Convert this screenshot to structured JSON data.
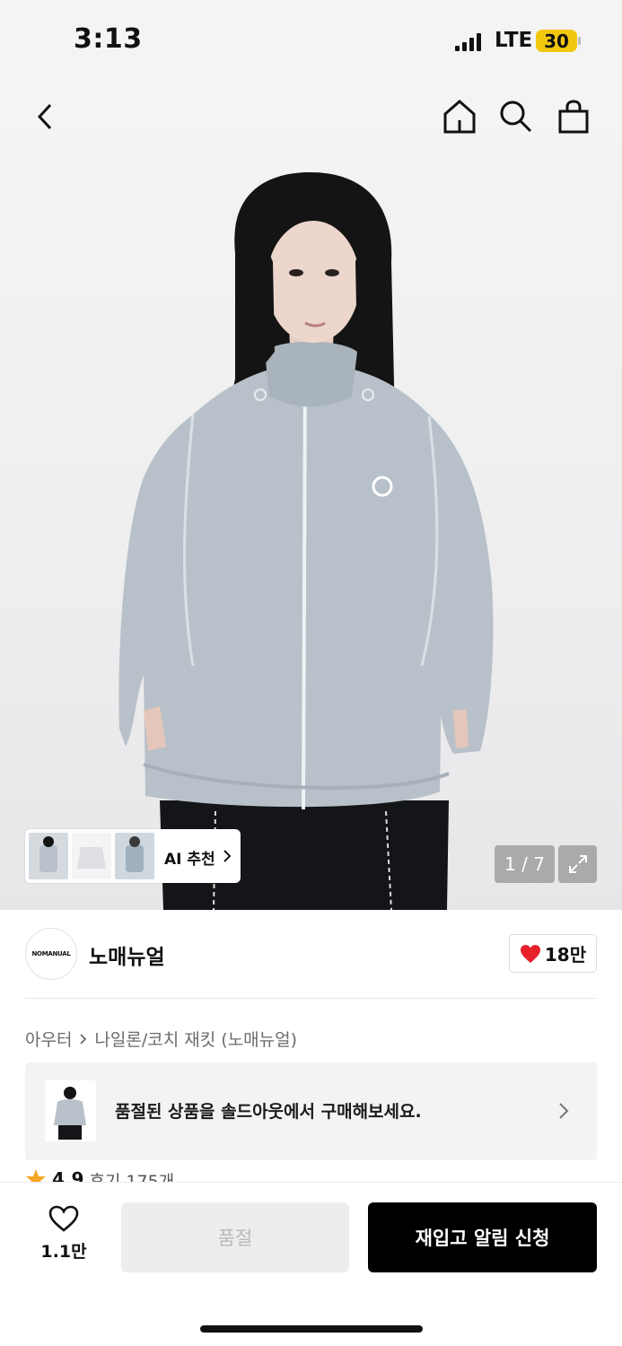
{
  "status_bar": {
    "time": "3:13",
    "network": "LTE",
    "battery": "30"
  },
  "nav": {
    "back_icon": "chevron-left-icon",
    "home_icon": "home-icon",
    "search_icon": "search-icon",
    "bag_icon": "shopping-bag-icon"
  },
  "gallery": {
    "counter": "1 / 7",
    "ai_recommend_label": "AI 추천",
    "expand_icon": "expand-icon"
  },
  "brand": {
    "logo_text": "NOMANUAL",
    "name": "노매뉴얼",
    "like_count": "18만",
    "like_color": "#e8202a"
  },
  "breadcrumb": {
    "category": "아우터",
    "subcategory": "나일론/코치 재킷 (노매뉴얼)"
  },
  "soldout_banner": {
    "text": "품절된 상품을 솔드아웃에서 구매해보세요."
  },
  "rating": {
    "score": "4.9",
    "reviews": "후기 175개",
    "star_color": "#f5a623"
  },
  "bottom_bar": {
    "wish_count": "1.1만",
    "soldout_label": "품절",
    "restock_label": "재입고 알림 신청"
  },
  "colors": {
    "accent": "#000000",
    "jacket": "#b8c1c9",
    "hair": "#141414"
  }
}
